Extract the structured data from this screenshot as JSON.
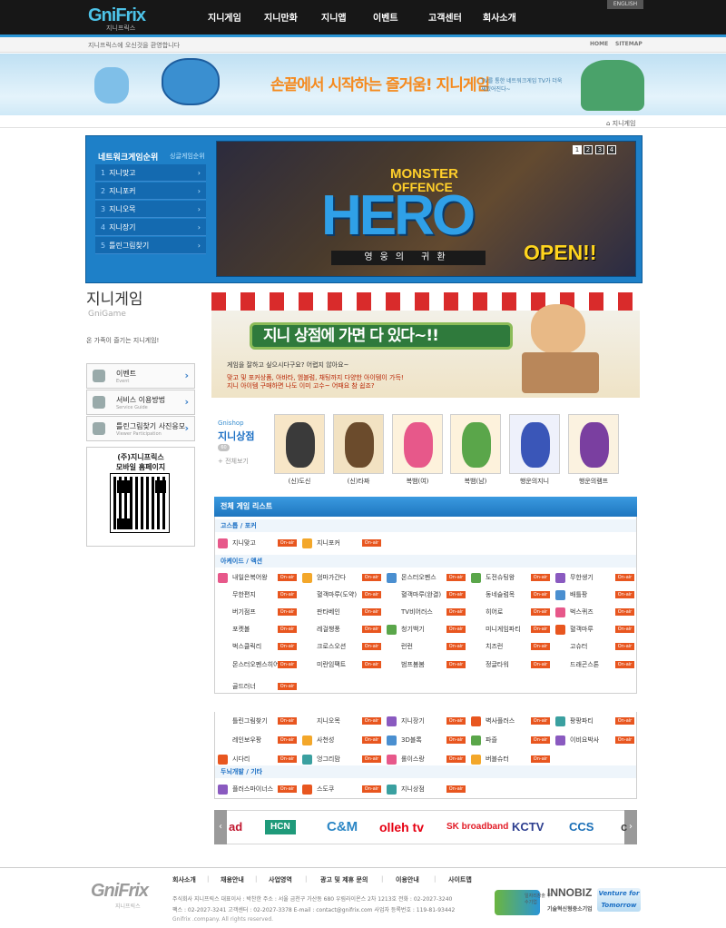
{
  "header": {
    "logo": "GniFrix",
    "logo_sub": "지니프릭스",
    "english": "ENGLISH",
    "nav": [
      "지니게임",
      "지니만화",
      "지니앱",
      "이벤트",
      "고객센터",
      "회사소개"
    ],
    "welcome": "지니프릭스에 오신것을 환영합니다",
    "home": "HOME",
    "sitemap": "SITEMAP"
  },
  "top_banner": {
    "slogan": "손끝에서 시작하는 즐거움! 지니게임",
    "sub": "TV를 통한 네트워크게임 TV가 더욱 재밌어진다~"
  },
  "location": "지니게임",
  "ranking": {
    "title": "네트워크게임순위",
    "subtitle": "싱글게임순위",
    "items": [
      {
        "num": "1",
        "label": "지니맞고"
      },
      {
        "num": "2",
        "label": "지니포커"
      },
      {
        "num": "3",
        "label": "지니오목"
      },
      {
        "num": "4",
        "label": "지니장기"
      },
      {
        "num": "5",
        "label": "틀린그림찾기"
      }
    ]
  },
  "hero": {
    "title1": "MONSTER",
    "title2": "OFFENCE",
    "big": "HERO",
    "sub": "영웅의 귀환",
    "open": "OPEN!!",
    "pages": [
      "1",
      "2",
      "3",
      "4"
    ]
  },
  "left": {
    "title": "지니게임",
    "title_en": "GniGame",
    "desc": "온 가족이 즐기는 지니게임!",
    "menu": [
      {
        "label": "이벤트",
        "sub": "Event"
      },
      {
        "label": "서비스 이용방법",
        "sub": "Service Guide"
      },
      {
        "label": "틀린그림찾기 사진응모",
        "sub": "Viewer Participation"
      }
    ],
    "qr_t1": "(주)지니프릭스",
    "qr_t2": "모바일 홈페이지"
  },
  "shop_banner": {
    "title": "지니 상점에 가면 다 있다~!!",
    "l1": "게임을 잘하고 싶으시다구요? 어렵지 않아요~",
    "l2": "맞고 및 포커상품, 아바타, 엠블럼, 채팅까지 다양한 아이템이 가득!",
    "l3": "지니 아이템 구매하면 나도 이미 고수~ 어때요 참 쉽죠?"
  },
  "gnishop": {
    "en": "Gnishop",
    "kr": "지니상점",
    "badge": "60",
    "all": "전체보기",
    "products": [
      "(신)도신",
      "(신)타짜",
      "복뱀(여)",
      "복뱀(남)",
      "행운의지니",
      "행운의램프"
    ]
  },
  "game_list": {
    "title": "전체 게임 리스트",
    "on_air": "On-air",
    "categories": [
      "고스톱 / 포커",
      "아케이드 / 액션",
      "두뇌개발 / 기타"
    ],
    "games_a": [
      "지니맞고",
      "지니포커"
    ],
    "games_b": [
      "내일은복어왕",
      "엄마가간다",
      "몬스터오펜스",
      "도전슈팅왕",
      "무한생기",
      "무한편지",
      "혈객마루(도약)",
      "혈객마루(완결)",
      "동네슬럼목",
      "배틀팡",
      "버기점프",
      "판타베인",
      "TV비어러스",
      "히어로",
      "벅스퀴즈",
      "포켓볼",
      "레걸챙풍",
      "청기백기",
      "미니게임파티",
      "혈객마루",
      "벅스클릭리",
      "크로스오션",
      "런런",
      "치즈런",
      "고슈터",
      "몬스터오펜스히어로",
      "미란임팩트",
      "범프봄봄",
      "정글타워",
      "드래곤스톤",
      "골드러너"
    ],
    "games_c": [
      "틀린그림찾기",
      "지니오목",
      "지니장기",
      "벽사플러스",
      "팡팡파티",
      "레인보우팡",
      "사천성",
      "3D블록",
      "파즐",
      "이비요박사",
      "시다리",
      "엉그리맘",
      "롤이스랑",
      "버블슈터"
    ],
    "games_d": [
      "플러스마이너스",
      "스도쿠",
      "지니상점"
    ]
  },
  "partners": [
    "ad",
    "HCN",
    "C&M",
    "olleh tv",
    "SK broadband",
    "KCTV",
    "CCS",
    "c"
  ],
  "footer": {
    "logo": "GniFrix",
    "logo_sub": "지니프릭스",
    "links": [
      "회사소개",
      "채용안내",
      "사업영역",
      "광고 및 제휴 문의",
      "이용안내",
      "사이트맵"
    ],
    "info1": "주식회사 지니프릭스   대표이사 : 박찬한   주소 : 서울 금천구 가산동 680 우림라이온스 2차 1213호   전화 : 02-2027-3240",
    "info2": "팩스 : 02-2027-3241   고객센터 : 02-2027-3378   E-mail : contact@gnifrix.com   사업자 등록번호 : 119-81-93442",
    "copy": "Gnifrix .company. All rights reserved.",
    "cert1": "일자리창출 우수기업",
    "cert2": "INNOBIZ",
    "cert2_sub": "기술혁신형중소기업",
    "cert3": "Venture for Tomorrow"
  }
}
